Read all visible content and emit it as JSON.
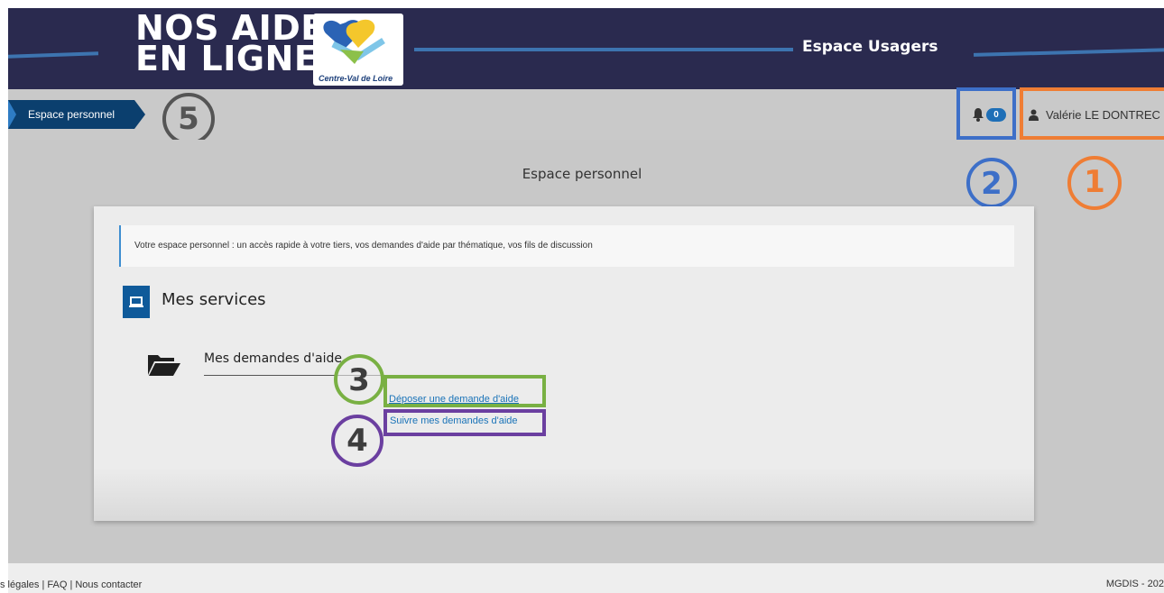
{
  "header": {
    "logo_line1": "NOS AIDES",
    "logo_line2": "EN LIGNE",
    "logo_subtitle": "Centre-Val de Loire",
    "title": "Espace Usagers"
  },
  "topbar": {
    "breadcrumb": "Espace personnel",
    "notification_count": "0",
    "user_name": "Valérie LE DONTREC"
  },
  "annotations": {
    "marker_1": "1",
    "marker_2": "2",
    "marker_3": "3",
    "marker_4": "4",
    "marker_5": "5",
    "colors": {
      "marker_1": "#ef7d34",
      "marker_2": "#3d6fc8",
      "marker_3": "#79b043",
      "marker_4": "#6b3fa0",
      "marker_5": "#555555"
    }
  },
  "main": {
    "page_title": "Espace personnel",
    "info_text": "Votre espace personnel : un accès rapide à votre tiers, vos demandes d'aide par thématique, vos fils de discussion",
    "services_title": "Mes services",
    "demandes_title": "Mes demandes d'aide",
    "link_deposer": "Déposer une demande d'aide",
    "link_suivre": "Suivre mes demandes d'aide"
  },
  "footer": {
    "left": "s légales | FAQ | Nous contacter",
    "right": "MGDIS - 202"
  },
  "icons": {
    "bell": "bell-icon",
    "user": "user-icon",
    "laptop": "laptop-icon",
    "folder": "folder-open-icon"
  }
}
